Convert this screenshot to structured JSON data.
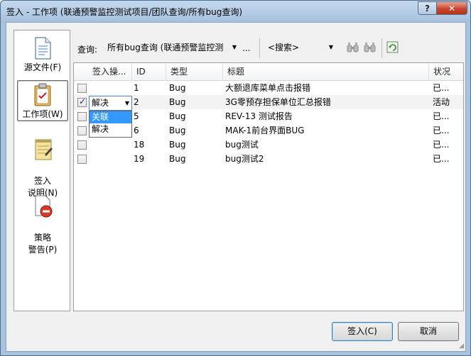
{
  "window": {
    "title": "签入 - 工作项 (联通预警监控测试项目/团队查询/所有bug查询)",
    "help_label": "?",
    "close_label": "✕"
  },
  "nav": {
    "items": [
      {
        "label": "源文件(F)",
        "icon": "document-icon"
      },
      {
        "label": "工作项(W)",
        "icon": "clipboard-icon",
        "selected": true
      },
      {
        "label": "签入\n说明(N)",
        "icon": "notepad-icon"
      },
      {
        "label": "策略\n警告(P)",
        "icon": "warning-icon"
      }
    ]
  },
  "toolbar": {
    "query_label": "查询:",
    "query_value": "所有bug查询 (联通预警监控测",
    "ellipsis": "...",
    "search_value": "<搜索>"
  },
  "table": {
    "columns": [
      "签入操...",
      "ID",
      "类型",
      "标题",
      "状况"
    ],
    "rows": [
      {
        "checked": false,
        "action": "",
        "id": "1",
        "type": "Bug",
        "title": "大额退库菜单点击报错",
        "status": "已..."
      },
      {
        "checked": true,
        "action": "解决",
        "id": "2",
        "type": "Bug",
        "title": "3G零预存担保单位汇总报错",
        "status": "活动"
      },
      {
        "checked": false,
        "action": "",
        "id": "5",
        "type": "Bug",
        "title": "REV-13 测试报告",
        "status": "已..."
      },
      {
        "checked": false,
        "action": "",
        "id": "6",
        "type": "Bug",
        "title": "MAK-1前台界面BUG",
        "status": "已..."
      },
      {
        "checked": false,
        "action": "",
        "id": "18",
        "type": "Bug",
        "title": "bug测试",
        "status": "已..."
      },
      {
        "checked": false,
        "action": "",
        "id": "19",
        "type": "Bug",
        "title": "bug测试2",
        "status": "已..."
      }
    ]
  },
  "dropdown": {
    "current": "解决",
    "options": [
      "关联",
      "解决"
    ],
    "highlighted_index": 0
  },
  "buttons": {
    "checkin": "签入(C)",
    "cancel": "取消"
  },
  "colors": {
    "accent": "#3399ff",
    "frame": "#a9c3de",
    "close": "#c9462c"
  }
}
